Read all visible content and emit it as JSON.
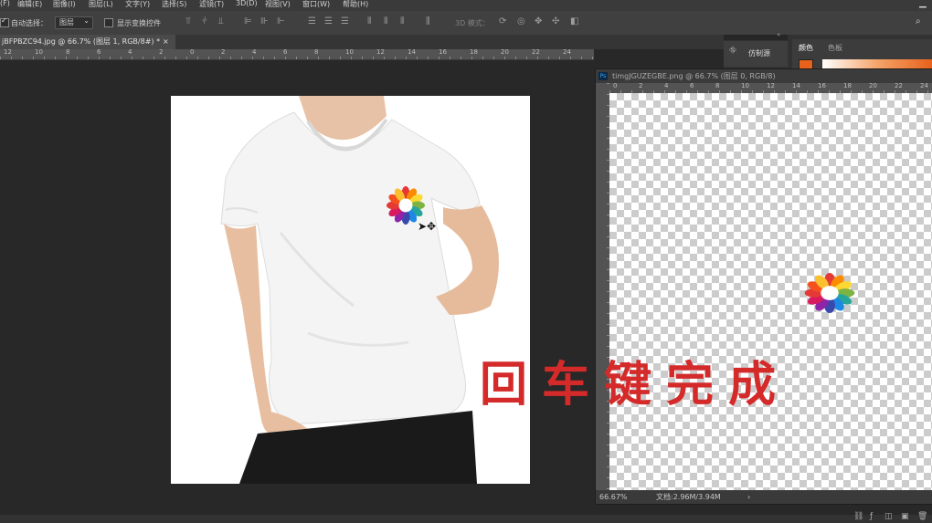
{
  "menu": [
    "(F)",
    "编辑(E)",
    "图像(I)",
    "图层(L)",
    "文字(Y)",
    "选择(S)",
    "滤镜(T)",
    "3D(D)",
    "视图(V)",
    "窗口(W)",
    "帮助(H)"
  ],
  "options": {
    "auto_select_label": "自动选择：",
    "auto_select_value": "图层",
    "show_transform_label": "显示变换控件",
    "mode3d_label": "3D 模式："
  },
  "document": {
    "tab_title": "jBFPBZC94.jpg @ 66.7% (图层 1, RGB/8#) *",
    "tab_close": "×"
  },
  "ruler_numbers": [
    "12",
    "10",
    "8",
    "6",
    "4",
    "2",
    "0",
    "2",
    "4",
    "6",
    "8",
    "10",
    "12",
    "14",
    "16",
    "18",
    "20",
    "22",
    "24"
  ],
  "panels": {
    "clone_source": "仿制源",
    "color_tab": "颜色",
    "swatches_tab": "色板",
    "foreground_color": "#e8621c"
  },
  "window2": {
    "title": "timgJGUZEGBE.png @ 66.7% (图层 0, RGB/8)",
    "zoom": "66.67%",
    "doc_info": "文档:2.96M/3.94M",
    "arrow": "›"
  },
  "overlay_text": "回车键完成"
}
